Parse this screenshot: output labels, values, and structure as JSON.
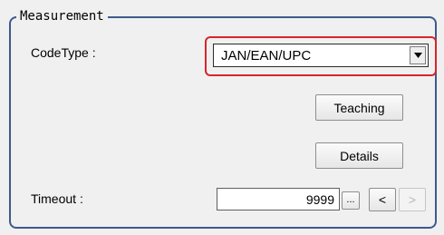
{
  "measurement": {
    "group_title": "Measurement",
    "code_type_label": "CodeType :",
    "code_type_value": "JAN/EAN/UPC",
    "code_type_arrow_icon": "triangle-down-icon",
    "teaching_label": "Teaching",
    "details_label": "Details",
    "timeout_label": "Timeout :",
    "timeout_value": "9999",
    "ellipsis_label": "...",
    "prev_label": "<",
    "next_label": ">"
  },
  "colors": {
    "highlight_border": "#d9242b",
    "group_border": "#3d5a8c"
  }
}
